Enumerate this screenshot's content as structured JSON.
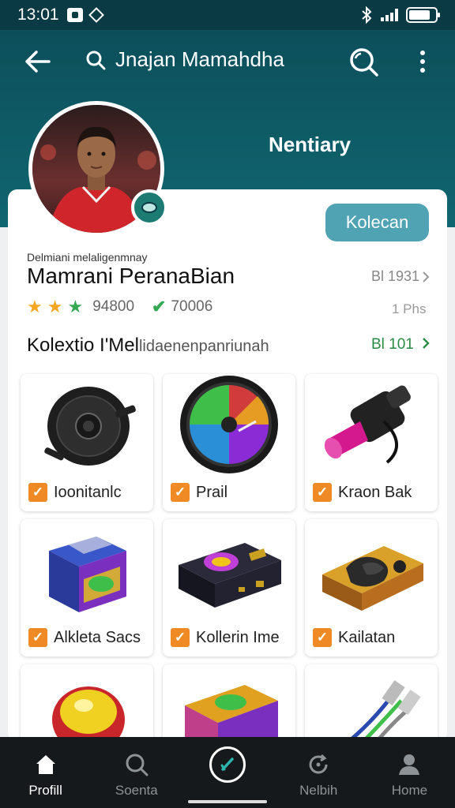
{
  "status_bar": {
    "time": "13:01",
    "battery_level": 0.8
  },
  "header": {
    "search_text": "Jnajan Mamahdha",
    "label": "Nentiary",
    "icons": [
      "back-arrow-icon",
      "search-icon",
      "more-vertical-icon"
    ]
  },
  "profile": {
    "subname": "Delmiani melaligenmnay",
    "name": "Mamrani PeranaBian",
    "collect_button": "Kolecan",
    "meta_top": "Bl 1931",
    "meta_bottom": "1 Phs",
    "rating_value": "94800",
    "verified_value": "70006",
    "stars": 3
  },
  "collection": {
    "title": "Kolextio I'Mel",
    "title_rest": "lidaenenpanriunah",
    "link": "Bl 101",
    "items": [
      {
        "label": "Ioonitanlc",
        "checked": true
      },
      {
        "label": "Prail",
        "checked": true
      },
      {
        "label": "Kraon Bak",
        "checked": true
      },
      {
        "label": "Alkleta Sacs",
        "checked": true
      },
      {
        "label": "Kollerin Ime",
        "checked": true
      },
      {
        "label": "Kailatan",
        "checked": true
      },
      {
        "label": "",
        "checked": false
      },
      {
        "label": "",
        "checked": false
      },
      {
        "label": "",
        "checked": false
      }
    ]
  },
  "bottom_nav": {
    "items": [
      {
        "label": "Profill",
        "icon": "home-icon",
        "active": true
      },
      {
        "label": "Soenta",
        "icon": "search-icon",
        "active": false
      },
      {
        "label": "",
        "icon": "check-circle-icon",
        "active": false
      },
      {
        "label": "Nelbih",
        "icon": "refresh-icon",
        "active": false
      },
      {
        "label": "Home",
        "icon": "person-icon",
        "active": false
      }
    ]
  },
  "colors": {
    "header_top": "#0c4f5b",
    "header_bottom": "#106670",
    "accent_button": "#4fa3b2",
    "check_orange": "#f08a24",
    "link_green": "#2a8a45",
    "nav_bg": "#15191b"
  }
}
